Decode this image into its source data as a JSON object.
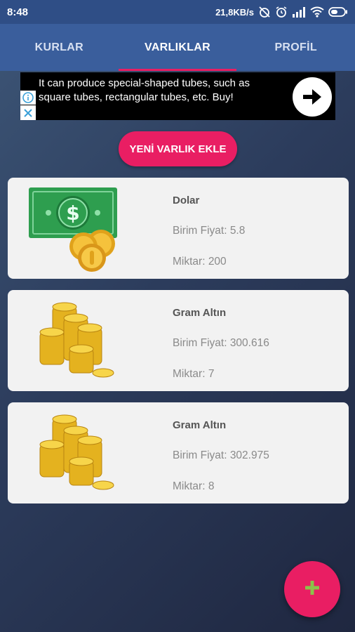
{
  "status_bar": {
    "time": "8:48",
    "network_speed": "21,8KB/s",
    "icons": [
      "alarm-off-icon",
      "alarm-icon",
      "signal-icon",
      "wifi-icon",
      "battery-icon"
    ]
  },
  "tabs": [
    {
      "label": "KURLAR",
      "active": false
    },
    {
      "label": "VARLIKLAR",
      "active": true
    },
    {
      "label": "PROFİL",
      "active": false
    }
  ],
  "ad": {
    "text": "It can produce special-shaped tubes, such as square tubes, rectangular tubes, etc. Buy!",
    "icons": [
      "info-icon",
      "close-icon",
      "arrow-right-icon"
    ]
  },
  "new_asset_button": "YENİ VARLIK EKLE",
  "assets": [
    {
      "name": "Dolar",
      "price_label": "Birim Fiyat:",
      "price": "5.8",
      "qty_label": "Miktar:",
      "qty": "200",
      "icon": "dollar-cash-icon"
    },
    {
      "name": "Gram Altın",
      "price_label": "Birim Fiyat:",
      "price": "300.616",
      "qty_label": "Miktar:",
      "qty": "7",
      "icon": "gold-coins-icon"
    },
    {
      "name": "Gram Altın",
      "price_label": "Birim Fiyat:",
      "price": "302.975",
      "qty_label": "Miktar:",
      "qty": "8",
      "icon": "gold-coins-icon"
    }
  ],
  "fab": {
    "icon": "plus-icon",
    "label": "+"
  },
  "colors": {
    "accent": "#e91e63",
    "tab_bar": "#3a5e9c",
    "status_bar": "#2f4e86",
    "card": "#f2f2f2"
  }
}
